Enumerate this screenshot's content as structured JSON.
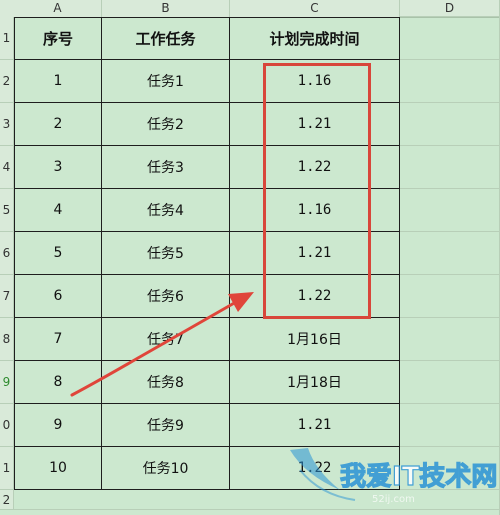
{
  "columns": [
    "A",
    "B",
    "C",
    "D"
  ],
  "row_numbers": [
    "1",
    "2",
    "3",
    "4",
    "5",
    "6",
    "7",
    "8",
    "9",
    "0",
    "1",
    "2"
  ],
  "table": {
    "headers": [
      "序号",
      "工作任务",
      "计划完成时间"
    ],
    "rows": [
      {
        "no": "1",
        "task": "任务1",
        "date": "1.16"
      },
      {
        "no": "2",
        "task": "任务2",
        "date": "1.21"
      },
      {
        "no": "3",
        "task": "任务3",
        "date": "1.22"
      },
      {
        "no": "4",
        "task": "任务4",
        "date": "1.16"
      },
      {
        "no": "5",
        "task": "任务5",
        "date": "1.21"
      },
      {
        "no": "6",
        "task": "任务6",
        "date": "1.22"
      },
      {
        "no": "7",
        "task": "任务7",
        "date": "1月16日"
      },
      {
        "no": "8",
        "task": "任务8",
        "date": "1月18日"
      },
      {
        "no": "9",
        "task": "任务9",
        "date": "1.21"
      },
      {
        "no": "10",
        "task": "任务10",
        "date": "1.22"
      }
    ]
  },
  "colors": {
    "sheet_bg": "#cce8cf",
    "highlight": "#d8463a",
    "grid": "#1e1e1e"
  },
  "watermark": {
    "text": "我爱IT技术网",
    "sub": "52ij.com"
  }
}
